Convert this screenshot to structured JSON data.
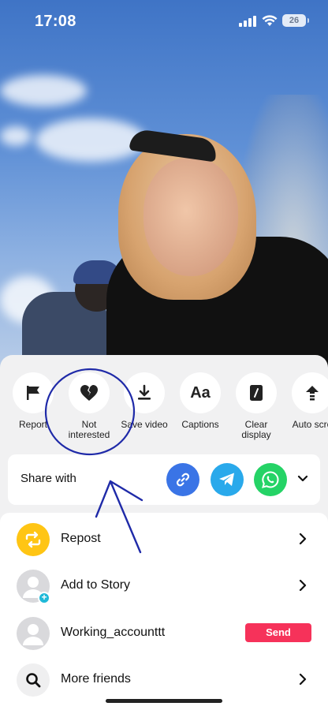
{
  "status_bar": {
    "time": "17:08",
    "battery": "26"
  },
  "actions": [
    {
      "label": "Report",
      "icon": "flag-icon"
    },
    {
      "label": "Not\ninterested",
      "icon": "broken-heart-icon"
    },
    {
      "label": "Save video",
      "icon": "download-icon"
    },
    {
      "label": "Captions",
      "icon": "captions-icon"
    },
    {
      "label": "Clear\ndisplay",
      "icon": "clear-display-icon"
    },
    {
      "label": "Auto scro",
      "icon": "auto-scroll-icon"
    }
  ],
  "share": {
    "label": "Share with",
    "targets": [
      {
        "name": "copy-link",
        "icon": "link-icon",
        "color": "#3a74e6"
      },
      {
        "name": "telegram",
        "icon": "telegram-icon",
        "color": "#29a9eb"
      },
      {
        "name": "whatsapp",
        "icon": "whatsapp-icon",
        "color": "#25d366"
      }
    ]
  },
  "list": [
    {
      "label": "Repost",
      "icon": "repost-icon",
      "color": "#ffc514"
    },
    {
      "label": "Add to Story",
      "icon": "avatar-icon"
    },
    {
      "label": "Working_accounttt",
      "icon": "avatar-icon",
      "action": "Send"
    },
    {
      "label": "More friends",
      "icon": "search-icon"
    }
  ],
  "colors": {
    "send": "#f6325a",
    "annotation": "#1f2aa8"
  }
}
